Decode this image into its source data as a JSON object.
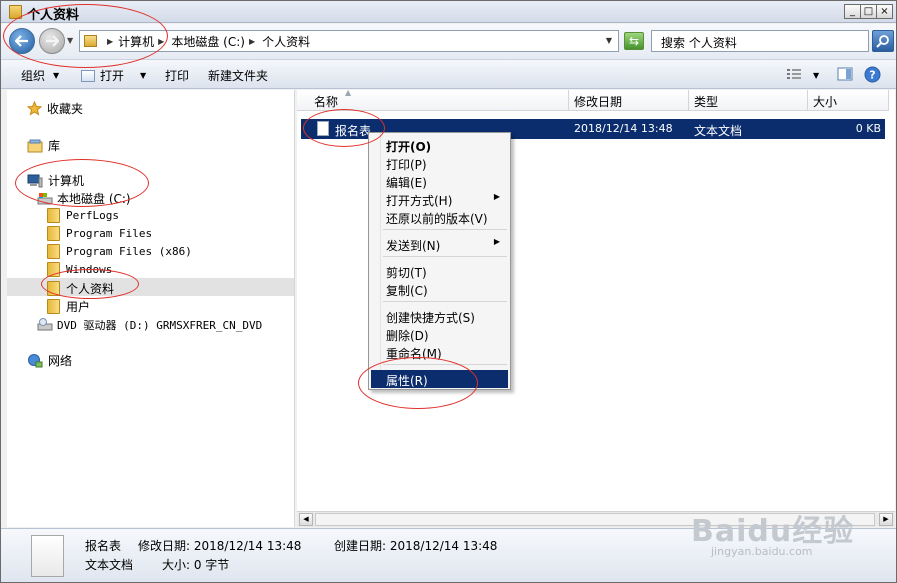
{
  "window": {
    "title": "个人资料",
    "controls": [
      "_",
      "□",
      "×"
    ]
  },
  "address": {
    "crumbs": [
      "计算机",
      "本地磁盘 (C:)",
      "个人资料"
    ],
    "search_text": "搜索 个人资料"
  },
  "toolbar": {
    "organize": "组织",
    "open": "打开",
    "print": "打印",
    "new_folder": "新建文件夹"
  },
  "nav": {
    "favorites": "收藏夹",
    "libraries": "库",
    "computer": "计算机",
    "local_disk": "本地磁盘 (C:)",
    "folders": [
      "PerfLogs",
      "Program Files",
      "Program Files (x86)",
      "Windows",
      "个人资料",
      "用户"
    ],
    "dvd": "DVD 驱动器 (D:) GRMSXFRER_CN_DVD",
    "network": "网络"
  },
  "columns": {
    "name": "名称",
    "modified": "修改日期",
    "type": "类型",
    "size": "大小"
  },
  "file": {
    "name": "报名表",
    "modified": "2018/12/14 13:48",
    "type": "文本文档",
    "size": "0 KB"
  },
  "context_menu": {
    "open": "打开(O)",
    "print": "打印(P)",
    "edit": "编辑(E)",
    "open_with": "打开方式(H)",
    "restore": "还原以前的版本(V)",
    "send_to": "发送到(N)",
    "cut": "剪切(T)",
    "copy": "复制(C)",
    "shortcut": "创建快捷方式(S)",
    "delete": "删除(D)",
    "rename": "重命名(M)",
    "properties": "属性(R)"
  },
  "details": {
    "name": "报名表",
    "modified": "修改日期: 2018/12/14 13:48",
    "created": "创建日期: 2018/12/14 13:48",
    "type": "文本文档",
    "size": "大小: 0 字节"
  },
  "watermark": {
    "main": "Baidu经验",
    "sub": "jingyan.baidu.com"
  },
  "colors": {
    "selection": "#0b2c6d",
    "annotation": "#e0302a"
  }
}
